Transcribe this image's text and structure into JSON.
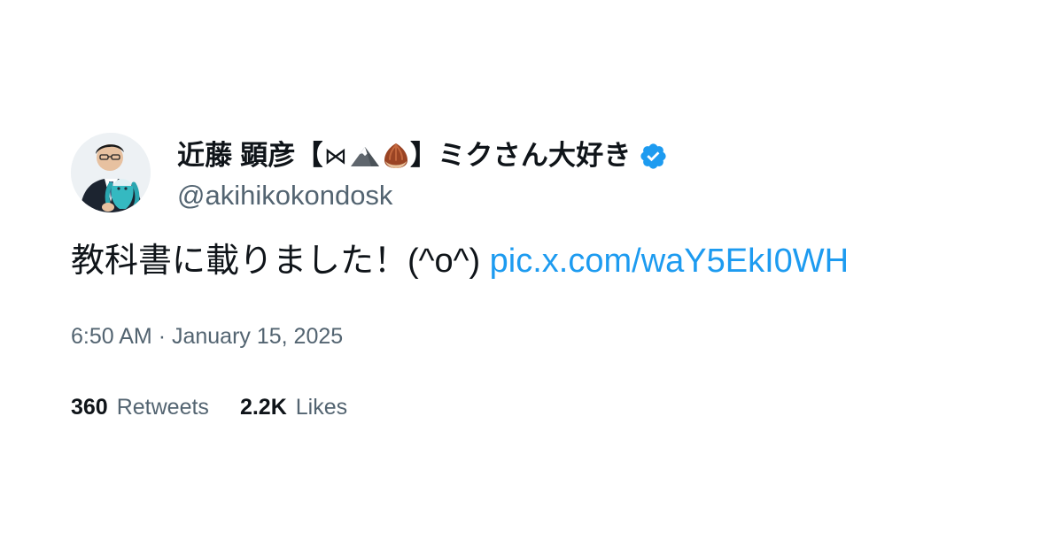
{
  "author": {
    "display_name_prefix": "近藤 顕彦【",
    "name_symbol": "⋈",
    "display_name_suffix": "】ミクさん大好き",
    "emoji_icons": [
      "snow-capped-mountain-icon",
      "chestnut-icon"
    ],
    "verified": true,
    "handle": "@akihikokondosk"
  },
  "tweet": {
    "text": "教科書に載りました！(^o^) ",
    "link_text": "pic.x.com/waY5EkI0WH"
  },
  "meta": {
    "time": "6:50 AM",
    "separator": "·",
    "date": "January 15, 2025"
  },
  "stats": {
    "retweets_count": "360",
    "retweets_label": "Retweets",
    "likes_count": "2.2K",
    "likes_label": "Likes"
  },
  "colors": {
    "link": "#1d9bf0",
    "secondary_text": "#536471",
    "primary_text": "#0f1419",
    "verified_badge": "#1d9bf0"
  }
}
